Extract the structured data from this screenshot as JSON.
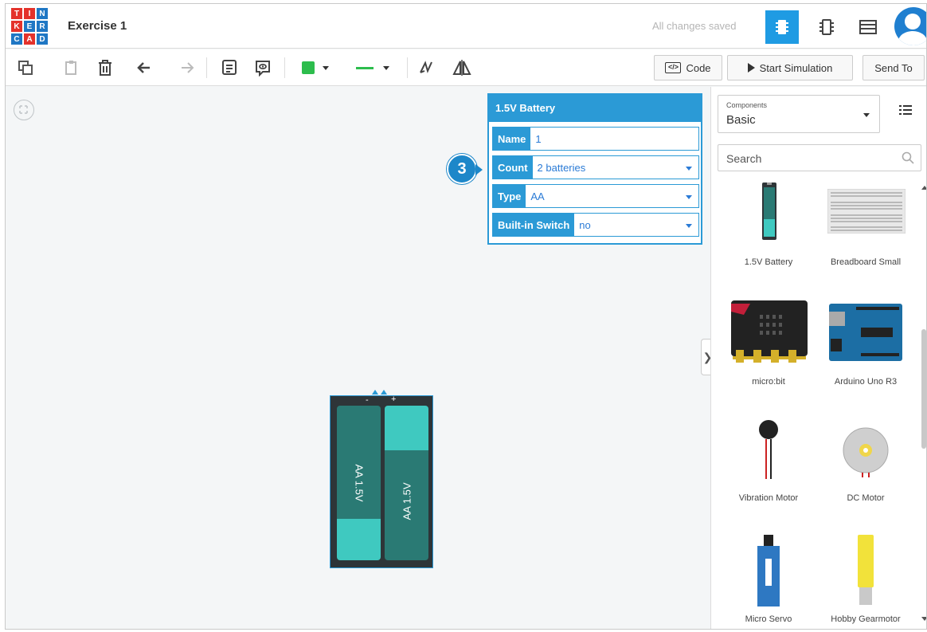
{
  "header": {
    "logo_letters": [
      "T",
      "I",
      "N",
      "K",
      "E",
      "R",
      "C",
      "A",
      "D"
    ],
    "logo_colors": [
      "#e4322b",
      "#e4322b",
      "#1f77c4",
      "#e4322b",
      "#1f77c4",
      "#1f77c4",
      "#1f77c4",
      "#e4322b",
      "#1f77c4"
    ],
    "title": "Exercise 1",
    "save_status": "All changes saved",
    "view_icons": [
      "circuit-view-icon",
      "schematic-view-icon",
      "component-list-icon"
    ]
  },
  "toolbar": {
    "tools": [
      "copy-icon",
      "paste-icon",
      "delete-icon",
      "undo-icon",
      "redo-icon",
      "notes-icon",
      "view-notes-icon",
      "color-picker",
      "wire-type-picker",
      "rotate-icon",
      "flip-icon"
    ],
    "fill_color": "#2dbd4d",
    "wire_color": "#2dbd4d",
    "code_label": "Code",
    "simulate_label": "Start Simulation",
    "send_label": "Send To"
  },
  "inspector": {
    "title": "1.5V Battery",
    "fields": [
      {
        "label": "Name",
        "value": "1"
      },
      {
        "label": "Count",
        "value": "2 batteries"
      },
      {
        "label": "Type",
        "value": "AA"
      },
      {
        "label": "Built-in Switch",
        "value": "no"
      }
    ],
    "accent": "#2b9ad6"
  },
  "callout": {
    "number": "3"
  },
  "battery": {
    "cells": [
      "AA 1.5V",
      "AA 1.5V"
    ],
    "cell_color": "#2a7a74",
    "cap_color": "#3fc9c0",
    "terminal_minus": "-",
    "terminal_plus": "+"
  },
  "panel": {
    "selector_small": "Components",
    "selector_value": "Basic",
    "search_placeholder": "Search",
    "components": [
      {
        "name": "1.5V Battery",
        "icon": "battery-icon"
      },
      {
        "name": "Breadboard Small",
        "icon": "breadboard-icon"
      },
      {
        "name": "micro:bit",
        "icon": "microbit-icon"
      },
      {
        "name": "Arduino Uno R3",
        "icon": "arduino-icon"
      },
      {
        "name": "Vibration Motor",
        "icon": "vibration-motor-icon"
      },
      {
        "name": "DC Motor",
        "icon": "dc-motor-icon"
      },
      {
        "name": "Micro Servo",
        "icon": "micro-servo-icon"
      },
      {
        "name": "Hobby Gearmotor",
        "icon": "gearmotor-icon"
      }
    ]
  }
}
